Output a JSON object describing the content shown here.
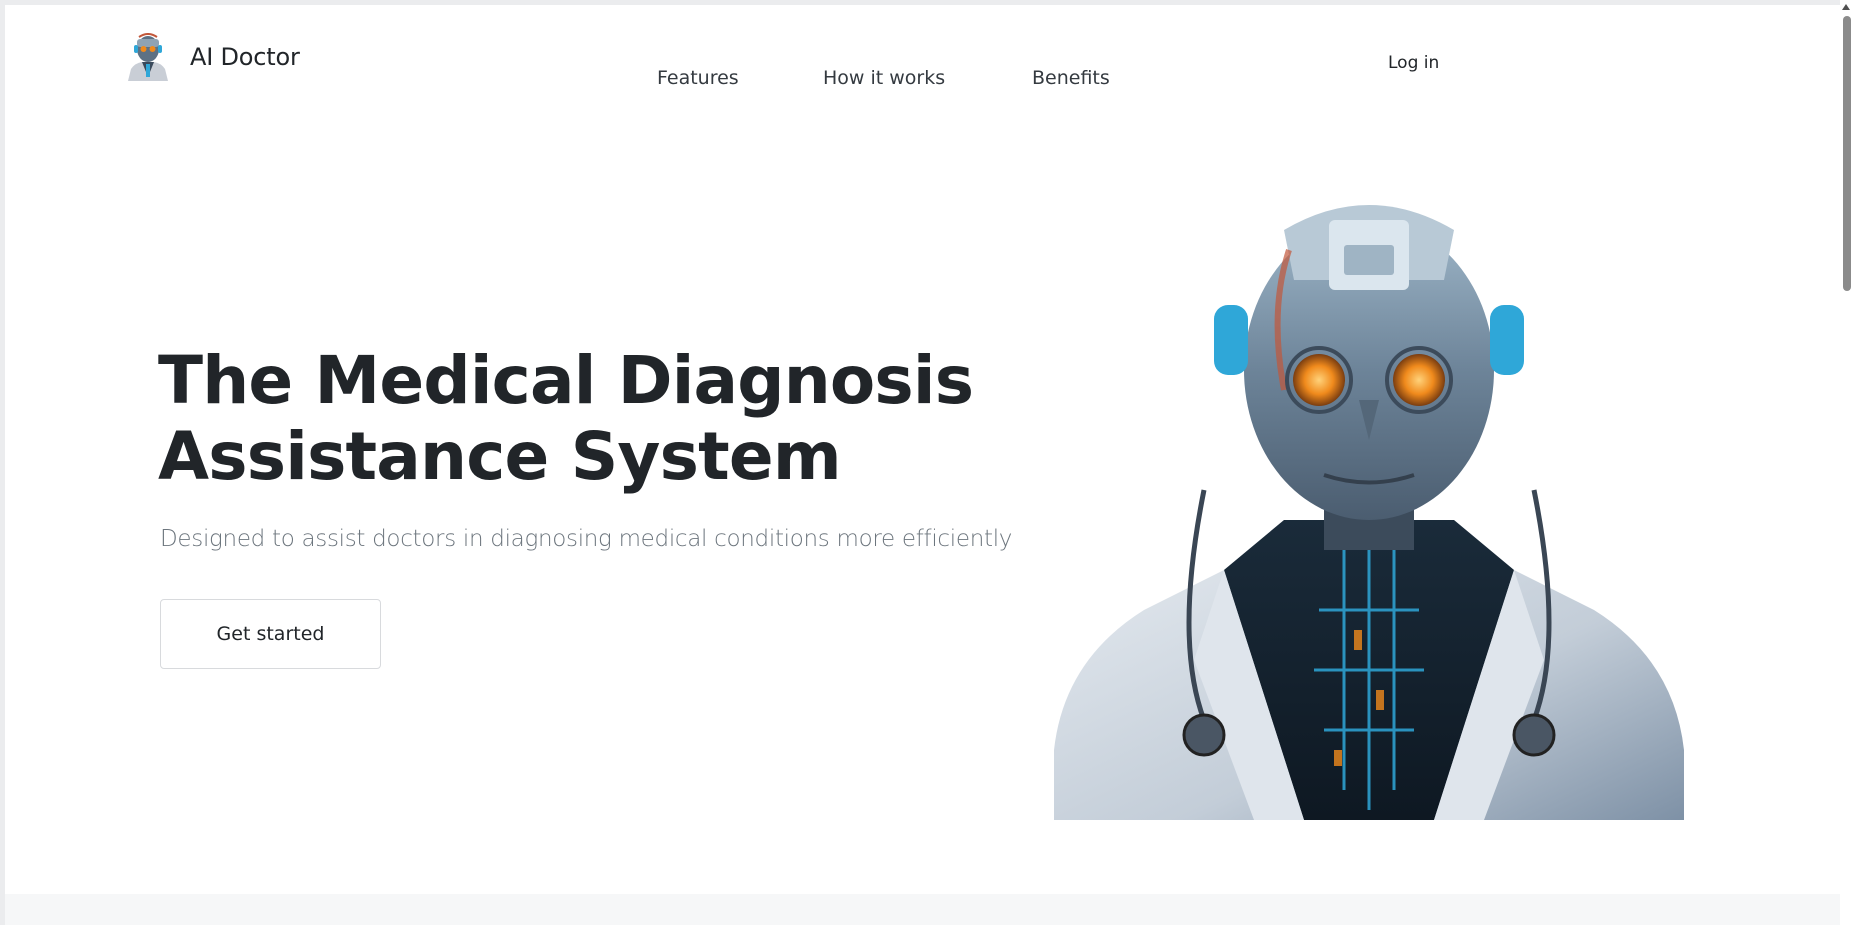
{
  "brand": {
    "name": "AI Doctor",
    "logo_icon": "robot-doctor-avatar-icon"
  },
  "nav": {
    "items": [
      {
        "label": "Features"
      },
      {
        "label": "How it works"
      },
      {
        "label": "Benefits"
      }
    ],
    "login_label": "Log in"
  },
  "hero": {
    "title_line1": "The Medical Diagnosis",
    "title_line2": "Assistance System",
    "subtitle": "Designed to assist doctors in diagnosing medical conditions more efficiently",
    "cta_label": "Get started",
    "image": "robot-doctor-illustration"
  },
  "colors": {
    "text_dark": "#212529",
    "text_muted": "#6c757d",
    "accent_blue": "#2fa7d8",
    "eye_orange": "#f08a1c"
  }
}
